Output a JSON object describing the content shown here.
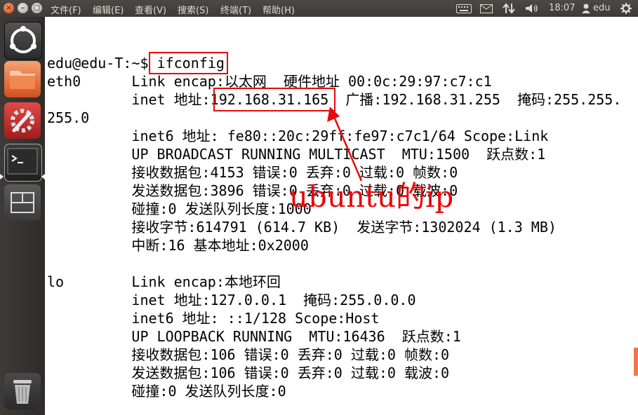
{
  "menubar": {
    "items": [
      "文件(F)",
      "编辑(E)",
      "查看(V)",
      "搜索(S)",
      "终端(T)",
      "帮助(H)"
    ]
  },
  "tray": {
    "time": "18:07",
    "user": "edu",
    "icons": [
      "keyboard-icon",
      "mail-icon",
      "network-icon",
      "volume-icon",
      "user-icon",
      "gear-icon"
    ]
  },
  "window_buttons": {
    "close": "×",
    "minimize": "–",
    "maximize": "□"
  },
  "terminal": {
    "lines": [
      "edu@edu-T:~$ ifconfig",
      "eth0      Link encap:以太网  硬件地址 00:0c:29:97:c7:c1",
      "          inet 地址:192.168.31.165  广播:192.168.31.255  掩码:255.255.",
      "255.0",
      "          inet6 地址: fe80::20c:29ff:fe97:c7c1/64 Scope:Link",
      "          UP BROADCAST RUNNING MULTICAST  MTU:1500  跃点数:1",
      "          接收数据包:4153 错误:0 丢弃:0 过载:0 帧数:0",
      "          发送数据包:3896 错误:0 丢弃:0 过载:0 载波:0",
      "          碰撞:0 发送队列长度:1000",
      "          接收字节:614791 (614.7 KB)  发送字节:1302024 (1.3 MB)",
      "          中断:16 基本地址:0x2000",
      "",
      "lo        Link encap:本地环回",
      "          inet 地址:127.0.0.1  掩码:255.0.0.0",
      "          inet6 地址: ::1/128 Scope:Host",
      "          UP LOOPBACK RUNNING  MTU:16436  跃点数:1",
      "          接收数据包:106 错误:0 丢弃:0 过载:0 帧数:0",
      "          发送数据包:106 错误:0 丢弃:0 过载:0 载波:0",
      "          碰撞:0 发送队列长度:0"
    ]
  },
  "annotation": {
    "text": "ubuntu的ip",
    "color": "#e8090a"
  }
}
